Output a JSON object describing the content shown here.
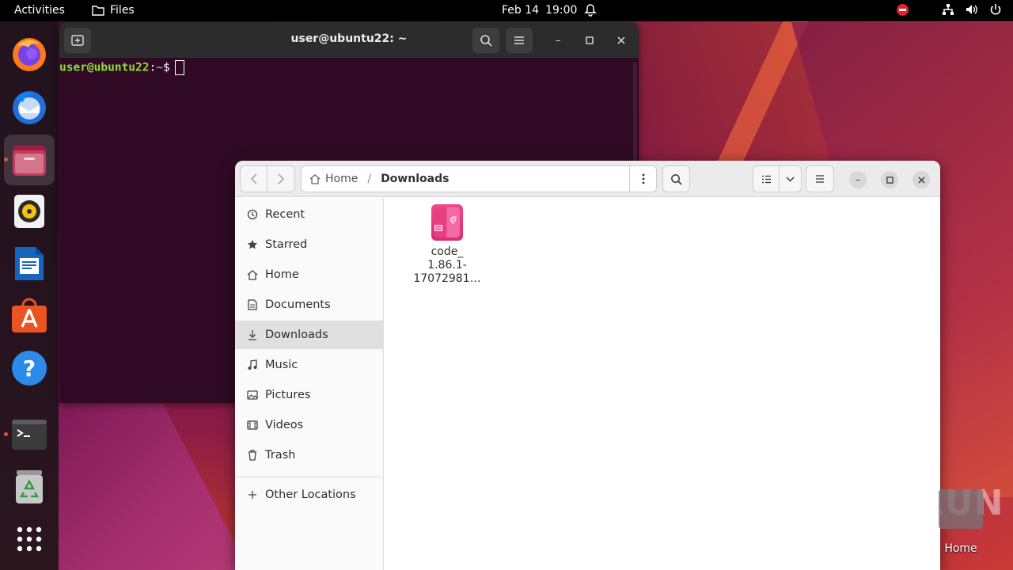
{
  "topbar": {
    "activities": "Activities",
    "app_name": "Files",
    "date": "Feb 14",
    "time": "19:00",
    "icons": [
      "bell-icon",
      "do-not-disturb-icon",
      "network-icon",
      "volume-icon",
      "power-icon"
    ]
  },
  "dock": {
    "items": [
      "firefox",
      "thunderbird",
      "files",
      "rhythmbox",
      "libreoffice-writer",
      "ubuntu-software",
      "help",
      "terminal",
      "trash",
      "show-applications"
    ]
  },
  "terminal": {
    "title": "user@ubuntu22: ~",
    "prompt_user": "user@ubuntu22",
    "prompt_colon": ":",
    "prompt_path": "~",
    "prompt_symbol": "$"
  },
  "files": {
    "path": {
      "home": "Home",
      "separator": "/",
      "current": "Downloads"
    },
    "sidebar": [
      {
        "label": "Recent",
        "icon": "clock-icon"
      },
      {
        "label": "Starred",
        "icon": "star-icon"
      },
      {
        "label": "Home",
        "icon": "home-icon"
      },
      {
        "label": "Documents",
        "icon": "document-icon"
      },
      {
        "label": "Downloads",
        "icon": "download-icon",
        "selected": true
      },
      {
        "label": "Music",
        "icon": "music-icon"
      },
      {
        "label": "Pictures",
        "icon": "picture-icon"
      },
      {
        "label": "Videos",
        "icon": "video-icon"
      },
      {
        "label": "Trash",
        "icon": "trash-icon"
      },
      {
        "label": "Other Locations",
        "icon": "plus-icon"
      }
    ],
    "files": [
      {
        "name_line1": "code_",
        "name_line2": "1.86.1-",
        "name_line3": "17072981…",
        "icon": "deb-package-icon"
      }
    ]
  },
  "desktop": {
    "home_label": "Home",
    "watermark": "ANY RUN"
  },
  "colors": {
    "terminal_bg": "#300a24",
    "prompt_user": "#8ae234",
    "prompt_path": "#729fcf",
    "accent": "#e95420"
  }
}
